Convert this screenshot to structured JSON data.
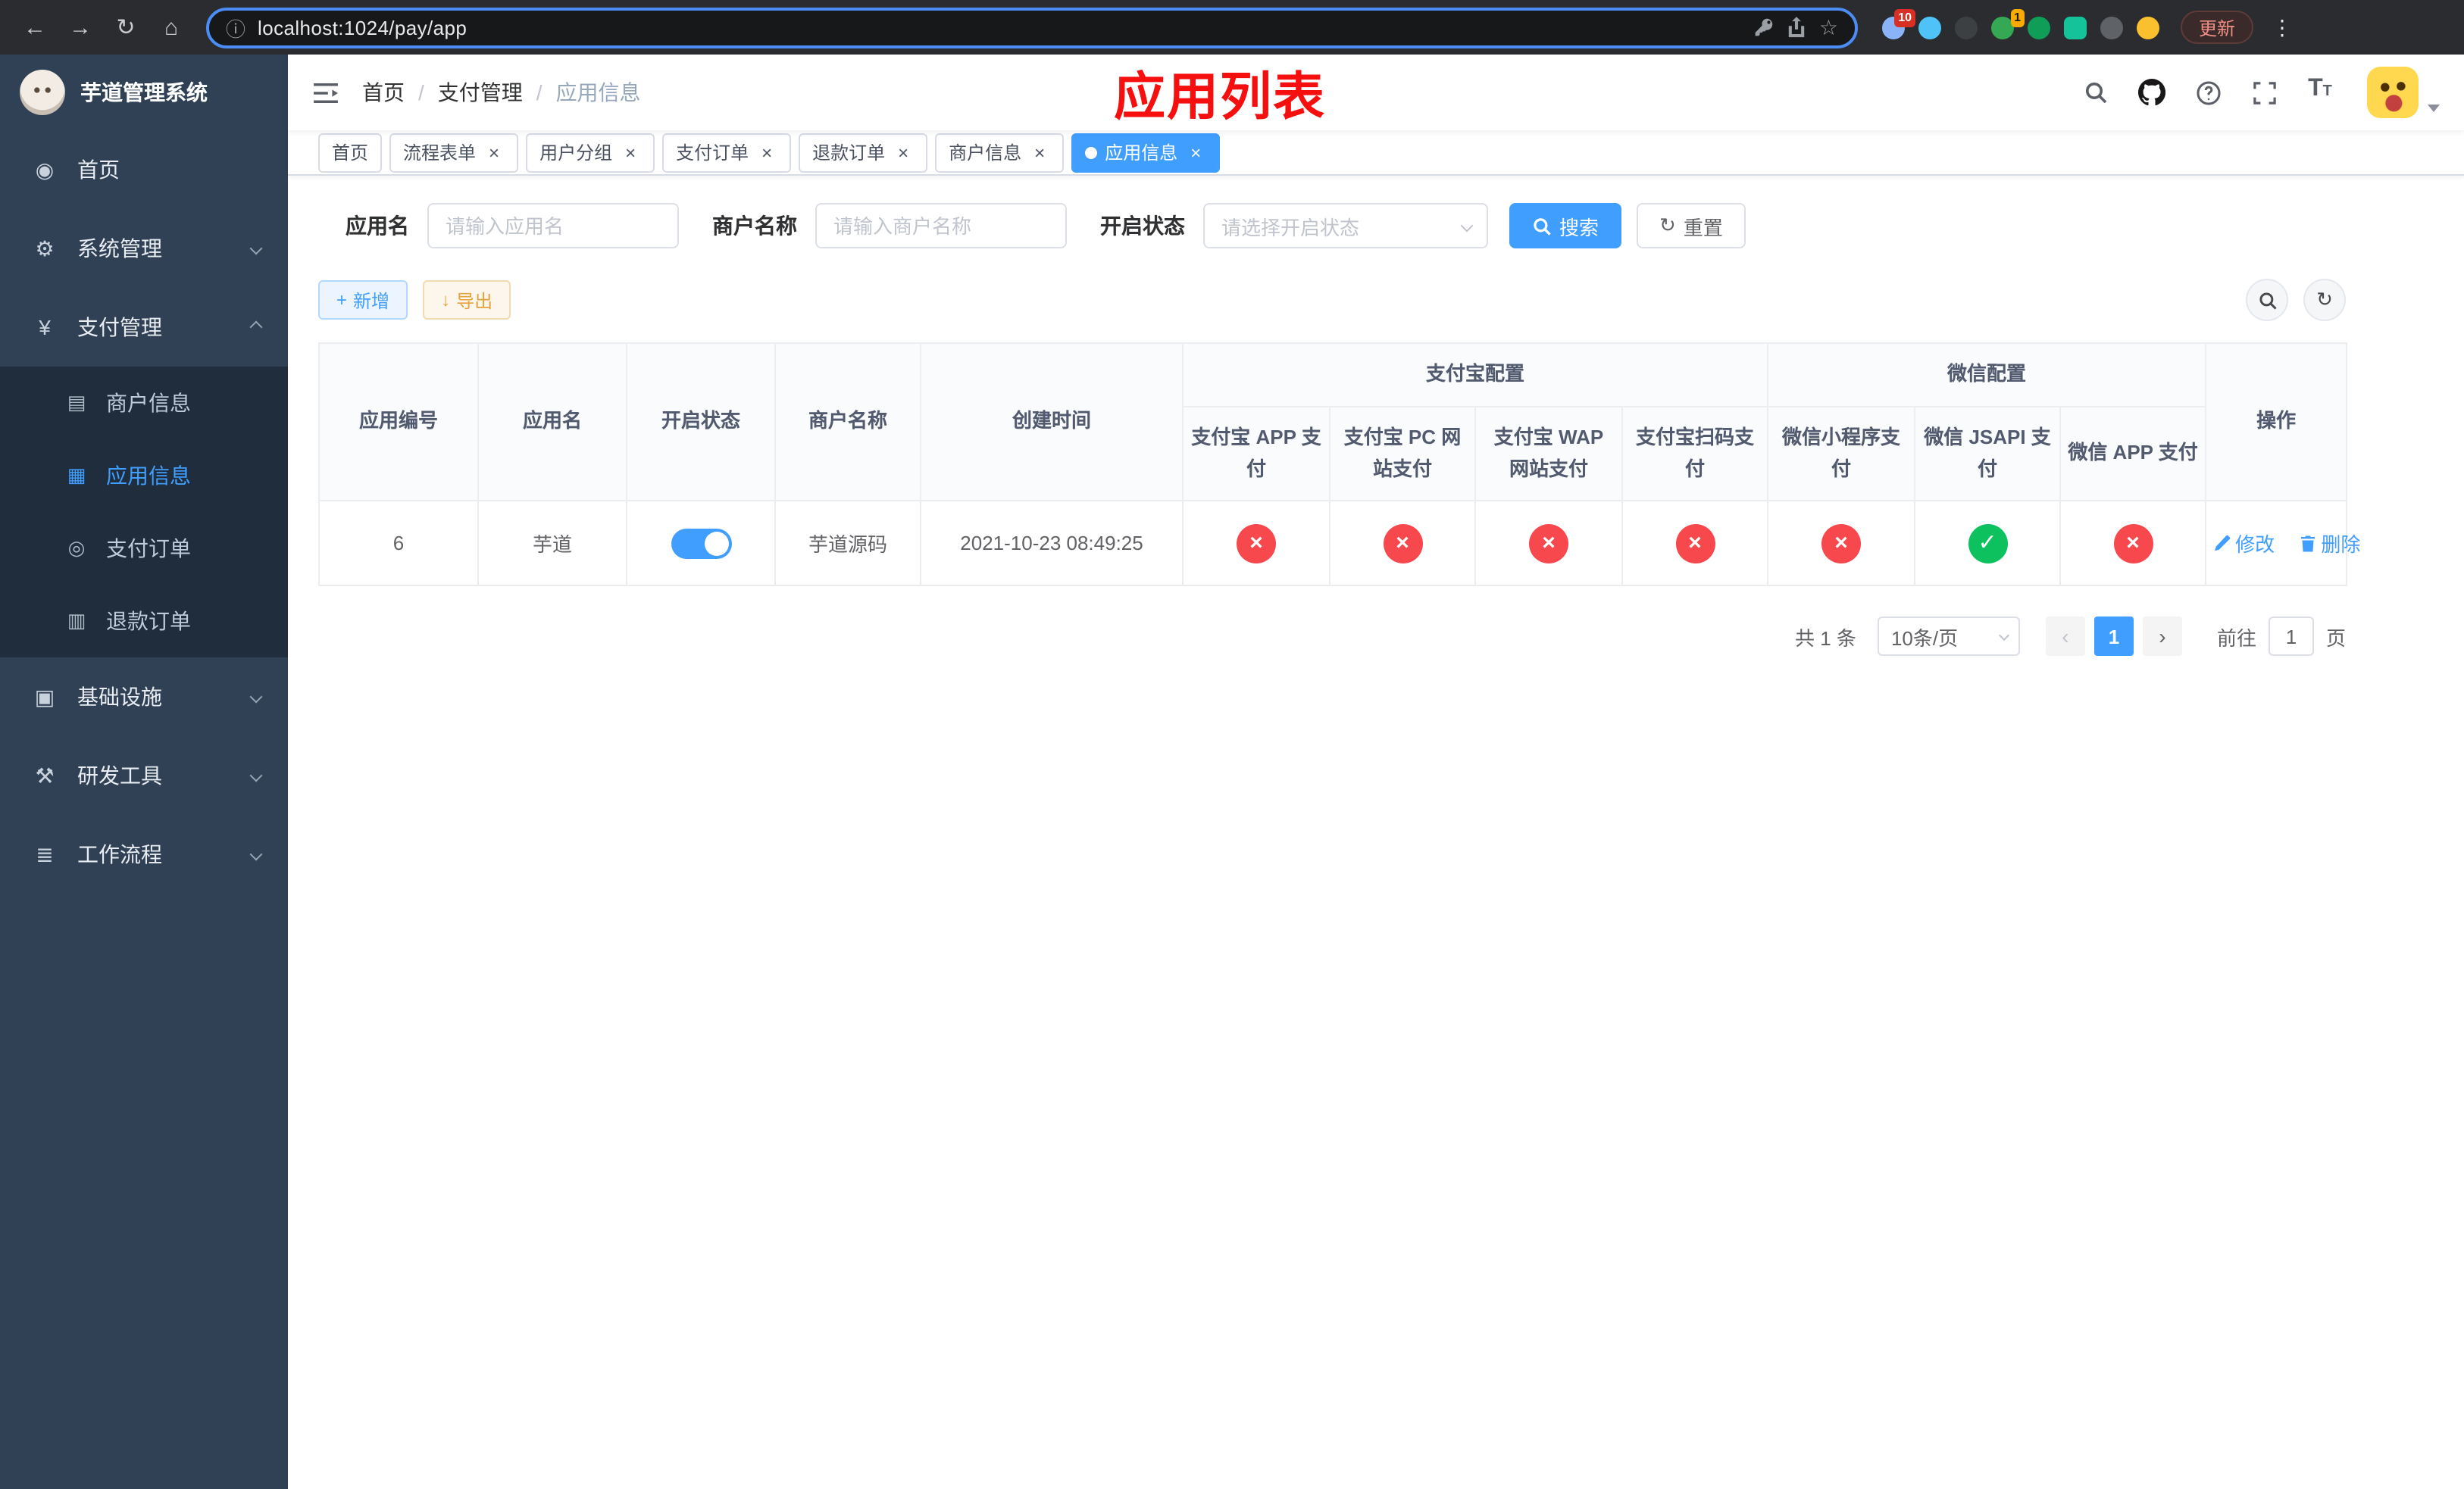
{
  "browser": {
    "url": "localhost:1024/pay/app",
    "update_button": "更新",
    "extension_badge_count": "10",
    "green_badge_count": "1"
  },
  "icons": {
    "back": "←",
    "forward": "→",
    "reload": "↻",
    "home": "⌂",
    "info": "ⓘ",
    "star": "☆",
    "menu_dots": "⋮",
    "close": "×",
    "plus": "+",
    "download": "↓",
    "refresh": "↻",
    "check": "✓",
    "cross": "×",
    "dashboard": "◉",
    "gear": "⚙",
    "yen": "¥",
    "merchant": "▤",
    "app_grid": "▦",
    "pay_order": "◎",
    "refund": "▥",
    "infra": "▣",
    "tools": "⚒",
    "workflow": "≣"
  },
  "sidebar": {
    "title": "芋道管理系统",
    "menu": {
      "home": "首页",
      "system": "系统管理",
      "payment": "支付管理",
      "merchant": "商户信息",
      "app_info": "应用信息",
      "pay_order": "支付订单",
      "refund_order": "退款订单",
      "infra": "基础设施",
      "dev_tools": "研发工具",
      "workflow": "工作流程"
    }
  },
  "breadcrumb": [
    "首页",
    "支付管理",
    "应用信息"
  ],
  "annotation": {
    "text": "应用列表",
    "color": "#f50f0f"
  },
  "tabs": [
    "首页",
    "流程表单",
    "用户分组",
    "支付订单",
    "退款订单",
    "商户信息",
    "应用信息"
  ],
  "filters": {
    "app_name": {
      "label": "应用名",
      "placeholder": "请输入应用名"
    },
    "merchant_name": {
      "label": "商户名称",
      "placeholder": "请输入商户名称"
    },
    "status": {
      "label": "开启状态",
      "placeholder": "请选择开启状态"
    },
    "search_button": "搜索",
    "reset_button": "重置"
  },
  "toolbar": {
    "add_button": "新增",
    "export_button": "导出"
  },
  "table": {
    "columns": {
      "app_id": "应用编号",
      "app_name": "应用名",
      "status": "开启状态",
      "merchant": "商户名称",
      "created": "创建时间",
      "alipay_group": "支付宝配置",
      "wechat_group": "微信配置",
      "alipay_app": "支付宝 APP 支付",
      "alipay_pc": "支付宝 PC 网站支付",
      "alipay_wap": "支付宝 WAP 网站支付",
      "alipay_qr": "支付宝扫码支付",
      "wx_lite": "微信小程序支付",
      "wx_jsapi": "微信 JSAPI 支付",
      "wx_app": "微信 APP 支付",
      "actions": "操作"
    },
    "rows": [
      {
        "app_id": "6",
        "app_name": "芋道",
        "enabled": true,
        "merchant": "芋道源码",
        "created": "2021-10-23 08:49:25",
        "config": {
          "alipay_app": false,
          "alipay_pc": false,
          "alipay_wap": false,
          "alipay_qr": false,
          "wx_lite": false,
          "wx_jsapi": true,
          "wx_app": false
        },
        "actions": {
          "edit": "修改",
          "delete": "删除"
        }
      }
    ]
  },
  "pagination": {
    "total": "共 1 条",
    "page_size": "10条/页",
    "prev": "‹",
    "next": "›",
    "page": "1",
    "goto_label": "前往",
    "goto_value": "1",
    "unit_label": "页"
  },
  "colors": {
    "primary": "#409EFF",
    "success_circle": "#0ec15f",
    "danger_circle": "#f7494d",
    "warning": "#e6a23c",
    "sidebar_bg": "#304156",
    "submenu_bg": "#1f2d3d"
  }
}
